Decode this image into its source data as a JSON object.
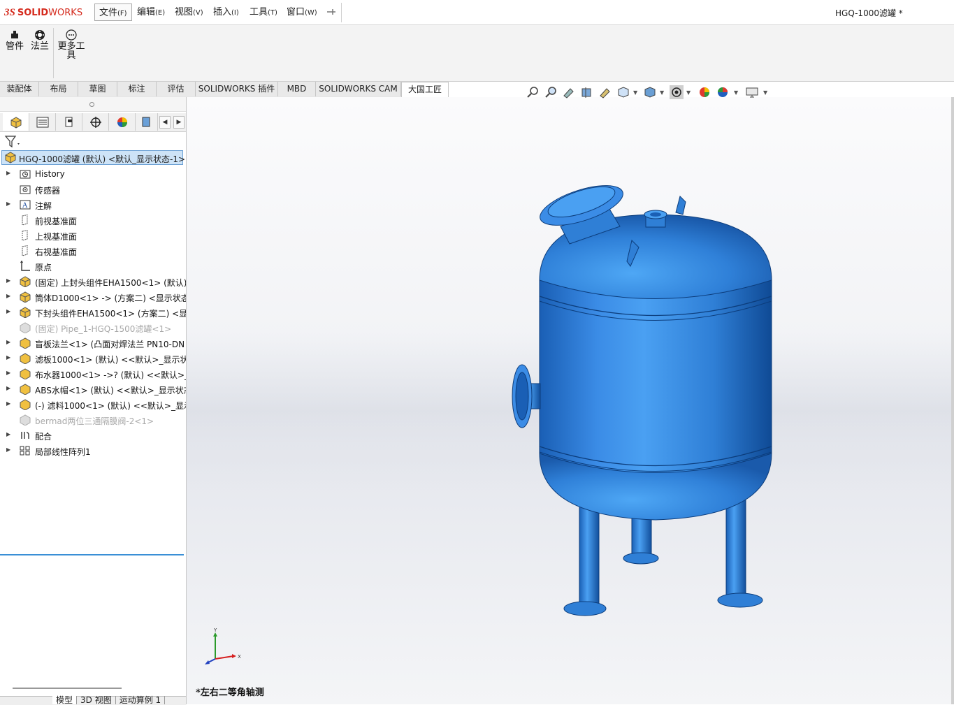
{
  "app": {
    "logo_ds": "3S",
    "logo_solid": "SOLID",
    "logo_works": "WORKS",
    "document_title": "HGQ-1000滤罐 *"
  },
  "menu": [
    {
      "label": "文件",
      "acc": "(F)"
    },
    {
      "label": "编辑",
      "acc": "(E)"
    },
    {
      "label": "视图",
      "acc": "(V)"
    },
    {
      "label": "插入",
      "acc": "(I)"
    },
    {
      "label": "工具",
      "acc": "(T)"
    },
    {
      "label": "窗口",
      "acc": "(W)"
    }
  ],
  "command_manager": {
    "pipe": "管件",
    "flange": "法兰",
    "more_tools_line1": "更多工",
    "more_tools_line2": "具"
  },
  "tabs": [
    "装配体",
    "布局",
    "草图",
    "标注",
    "评估",
    "SOLIDWORKS 插件",
    "MBD",
    "SOLIDWORKS CAM",
    "大国工匠"
  ],
  "tree": {
    "root": "HGQ-1000滤罐 (默认) <默认_显示状态-1>",
    "items": [
      {
        "label": "History",
        "expandable": true
      },
      {
        "label": "传感器",
        "expandable": false
      },
      {
        "label": "注解",
        "expandable": true
      },
      {
        "label": "前视基准面",
        "expandable": false
      },
      {
        "label": "上视基准面",
        "expandable": false
      },
      {
        "label": "右视基准面",
        "expandable": false
      },
      {
        "label": "原点",
        "expandable": false
      },
      {
        "label": "(固定) 上封头组件EHA1500<1> (默认)",
        "expandable": true
      },
      {
        "label": "筒体D1000<1> -> (方案二) <显示状态",
        "expandable": true
      },
      {
        "label": "下封头组件EHA1500<1> (方案二) <显示",
        "expandable": true
      },
      {
        "label": "(固定) Pipe_1-HGQ-1500滤罐<1>",
        "expandable": false,
        "dim": true
      },
      {
        "label": "盲板法兰<1> (凸面对焊法兰 PN10-DN",
        "expandable": true
      },
      {
        "label": "滤板1000<1> (默认) <<默认>_显示状态",
        "expandable": true
      },
      {
        "label": "布水器1000<1> ->? (默认) <<默认>_显",
        "expandable": true
      },
      {
        "label": "ABS水帽<1> (默认) <<默认>_显示状态",
        "expandable": true
      },
      {
        "label": "(-) 滤料1000<1> (默认) <<默认>_显示",
        "expandable": true
      },
      {
        "label": "bermad两位三通隔膜阀-2<1>",
        "expandable": false,
        "dim": true
      },
      {
        "label": "配合",
        "expandable": true
      },
      {
        "label": "局部线性阵列1",
        "expandable": true
      }
    ]
  },
  "bottom_tabs": [
    "模型",
    "3D 视图",
    "运动算例 1"
  ],
  "viewport": {
    "view_label": "*左右二等角轴测",
    "triad_x": "X",
    "triad_y": "Y"
  },
  "colors": {
    "tank_blue": "#2f7fd6",
    "selection_bg": "#cde3f7",
    "brand_red": "#d52b1e"
  }
}
